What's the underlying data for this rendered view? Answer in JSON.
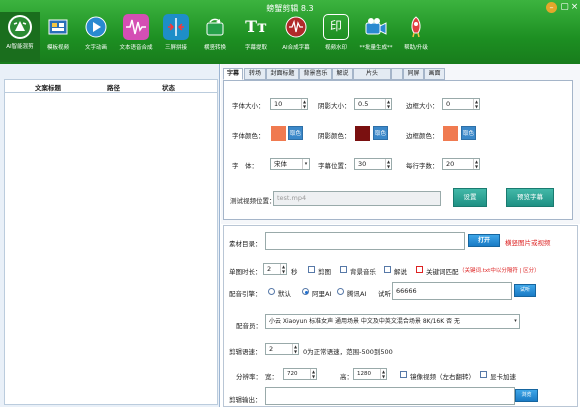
{
  "app": {
    "title": "螃蟹剪辑 8.3"
  },
  "toolbar": {
    "items": [
      {
        "label": "AI智能混剪"
      },
      {
        "label": "模板视频"
      },
      {
        "label": "文字动画"
      },
      {
        "label": "文本语音合成"
      },
      {
        "label": "三屏拼接"
      },
      {
        "label": "横竖转换"
      },
      {
        "label": "字幕提取"
      },
      {
        "label": "AI合成字幕"
      },
      {
        "label": "视频水印"
      },
      {
        "label": "**批量生成**"
      },
      {
        "label": "帮助/升级"
      }
    ],
    "title_icon_text": "Tт",
    "watermark_icon_text": "印"
  },
  "table": {
    "columns": [
      "文案标题",
      "路径",
      "状态"
    ]
  },
  "tabs": [
    "字幕",
    "转场",
    "封面标题",
    "背景音乐",
    "解说",
    "片头",
    "",
    "同屏",
    "画面"
  ],
  "subtitle": {
    "font_size_label": "字体大小：",
    "font_size": "10",
    "shadow_size_label": "阴影大小：",
    "shadow_size": "0.5",
    "border_size_label": "边框大小：",
    "border_size": "0",
    "font_color_label": "字体颜色：",
    "shadow_color_label": "阴影颜色：",
    "border_color_label": "边框颜色：",
    "color_button": "取色",
    "font_label": "字　体：",
    "font_value": "宋体",
    "position_label": "字幕位置：",
    "position_value": "30",
    "per_line_label": "每行字数：",
    "per_line_value": "20",
    "test_video_label": "测试视频位置：",
    "test_video_placeholder": "test.mp4",
    "settings_button": "设置",
    "preview_button": "预览字幕",
    "colors": {
      "font": "#f07a50",
      "shadow": "#7a1010",
      "border": "#f07a50"
    }
  },
  "main": {
    "material_label": "素材目录：",
    "open_button": "打开",
    "material_hint": "横竖图片或视频",
    "clip_duration_label": "单图时长：",
    "clip_duration": "2",
    "clip_unit": "秒",
    "chk_crop": "剪图",
    "chk_bgm": "背景音乐",
    "chk_narration": "解说",
    "chk_keyword": "关键词匹配",
    "keyword_hint": "（关键词.txt中以分隔符 | 区分）",
    "engine_label": "配音引擎：",
    "engine_default": "默认",
    "engine_ali": "阿里AI",
    "engine_tencent": "腾讯AI",
    "listen_label": "试听：",
    "listen_value": "66666",
    "play_button": "试听",
    "voice_label": "配音员：",
    "voice_value": "小云 Xiaoyun 标准女声 通用场景 中文及中英文混合场景 8K/16K 否 无",
    "speed_label": "剪辑语速：",
    "speed_value": "2",
    "speed_hint": "0为正常语速，范围-500到500",
    "resolution_label": "分辨率：",
    "width_label": "宽：",
    "width_value": "720",
    "height_label": "高：",
    "height_value": "1280",
    "chk_mirror": "镜像视频（左右翻转）",
    "chk_gpu": "显卡加速",
    "output_label": "剪辑输出：",
    "output_button": "浏览"
  }
}
